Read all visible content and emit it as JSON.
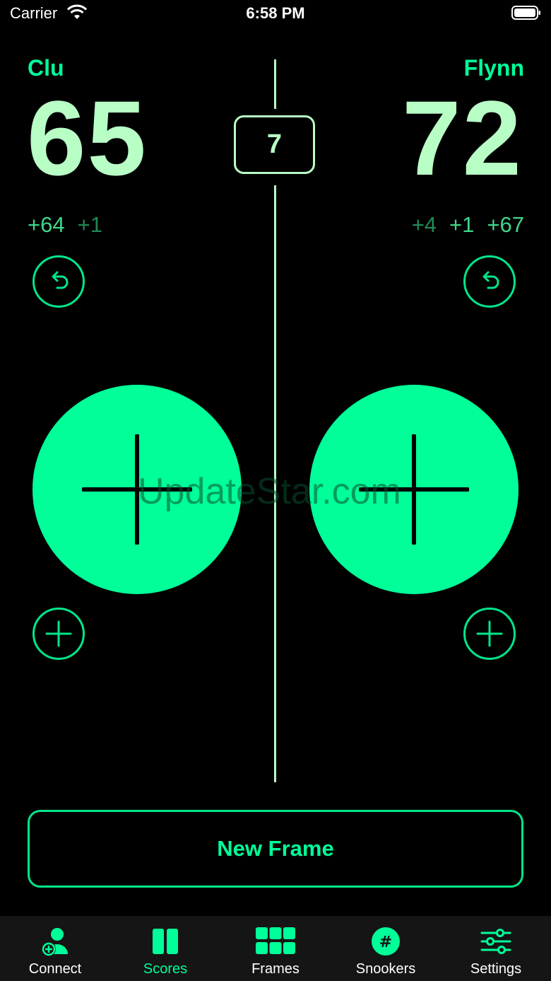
{
  "status_bar": {
    "carrier": "Carrier",
    "time": "6:58 PM"
  },
  "frame_number": "7",
  "players": {
    "left": {
      "name": "Clu",
      "score": "65",
      "breaks": [
        "+64",
        "+1"
      ]
    },
    "right": {
      "name": "Flynn",
      "score": "72",
      "breaks": [
        "+4",
        "+1",
        "+67"
      ]
    }
  },
  "watermark": "UpdateStar.com",
  "new_frame_label": "New Frame",
  "tabs": [
    {
      "label": "Connect",
      "icon": "connect-icon"
    },
    {
      "label": "Scores",
      "icon": "scores-icon",
      "active": true
    },
    {
      "label": "Frames",
      "icon": "frames-icon"
    },
    {
      "label": "Snookers",
      "icon": "snookers-icon"
    },
    {
      "label": "Settings",
      "icon": "settings-icon"
    }
  ],
  "colors": {
    "accent": "#00FF99",
    "score": "#B8FFC6",
    "background": "#000000"
  }
}
